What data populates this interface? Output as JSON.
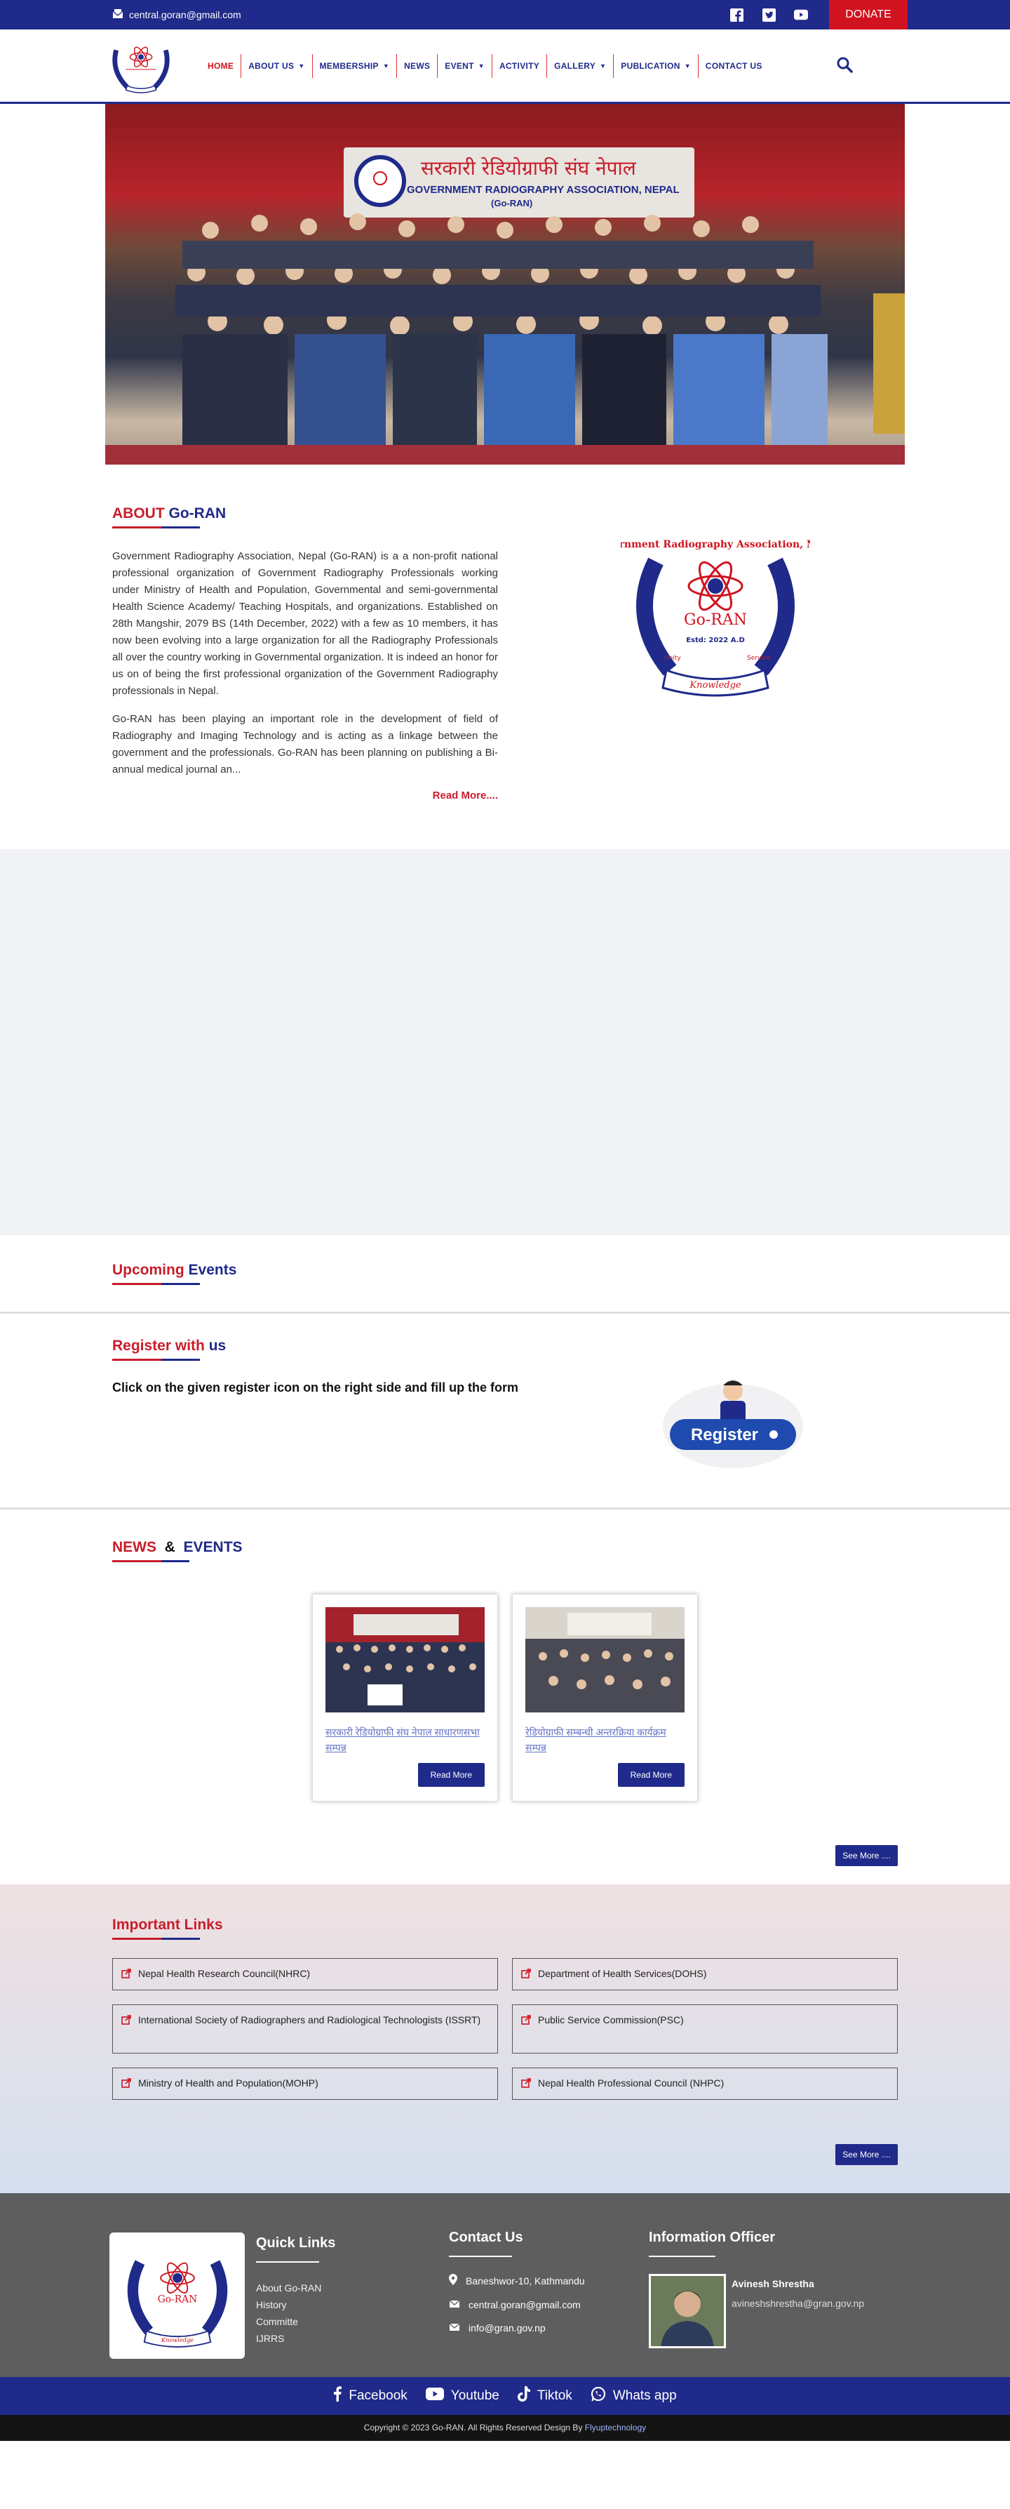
{
  "topbar": {
    "email": "central.goran@gmail.com",
    "donate": "DONATE",
    "social_icons": [
      "facebook-icon",
      "twitter-icon",
      "youtube-icon"
    ]
  },
  "nav": {
    "items": [
      {
        "label": "HOME",
        "dropdown": false
      },
      {
        "label": "ABOUT US",
        "dropdown": true
      },
      {
        "label": "MEMBERSHIP",
        "dropdown": true
      },
      {
        "label": "NEWS",
        "dropdown": false
      },
      {
        "label": "EVENT",
        "dropdown": true
      },
      {
        "label": "ACTIVITY",
        "dropdown": false
      },
      {
        "label": "GALLERY",
        "dropdown": true
      },
      {
        "label": "PUBLICATION",
        "dropdown": true
      },
      {
        "label": "CONTACT US",
        "dropdown": false
      }
    ]
  },
  "hero": {
    "banner_nepali": "सरकारी रेडियोग्राफी संघ नेपाल",
    "banner_english": "GOVERNMENT RADIOGRAPHY ASSOCIATION, NEPAL",
    "banner_abbr": "(Go-RAN)"
  },
  "about": {
    "title_a": "ABOUT",
    "title_b": "Go-RAN",
    "p1": "Government Radiography Association, Nepal (Go-RAN)  is a a non-profit national professional organization of Government Radiography Professionals working under Ministry of Health and Population, Governmental and semi-governmental Health Science Academy/ Teaching Hospitals, and  organizations. Established on 28th Mangshir, 2079 BS (14th December, 2022) with a few as 10 members, it has now been evolving into a large organization for all the Radiography Professionals all over the country working in Governmental organization. It is indeed an honor for us on of being the first professional organization of the Government Radiography professionals in Nepal.",
    "p2": "Go-RAN has been playing an important role in the development of field of Radiography and Imaging Technology and is acting as a linkage between the government and the professionals. Go-RAN has been planning on publishing a Bi-annual medical journal an...",
    "read_more": "Read More....",
    "logo_text": {
      "arc": "Government Radiography Association, Nepal",
      "name": "Go-RAN",
      "estd": "Estd: 2022 A.D",
      "ribbon": "Knowledge",
      "left": "Unity",
      "right": "Service"
    }
  },
  "upcoming": {
    "title_a": "Upcoming",
    "title_b": "Events"
  },
  "register": {
    "title_a": "Register with",
    "title_b": "us",
    "info": "Click on the given register icon on the right side and fill up the form",
    "button": "Register"
  },
  "news": {
    "title_a": "NEWS",
    "amp": "&",
    "title_b": "EVENTS",
    "cards": [
      {
        "caption": "सरकारी रेडियोग्राफी संघ नेपाल साधारणसभा सम्पन्न",
        "button": "Read More"
      },
      {
        "caption": "रेडियोग्राफी सम्बन्धी अन्तरक्रिया कार्यक्रम सम्पन्न",
        "button": "Read More"
      }
    ],
    "see_more": "See More ...."
  },
  "links": {
    "title": "Important Links",
    "items": [
      "Nepal Health Research Council(NHRC)",
      "Department of Health Services(DOHS)",
      "International Society of Radiographers and Radiological Technologists (ISSRT)",
      "Public Service Commission(PSC)",
      "Ministry of Health and Population(MOHP)",
      "Nepal Health Professional Council (NHPC)"
    ],
    "see_more": "See More ...."
  },
  "footer": {
    "quick_title": "Quick Links",
    "quick": [
      "About Go-RAN",
      "History",
      "Committe",
      "IJRRS"
    ],
    "contact_title": "Contact Us",
    "address": "Baneshwor-10, Kathmandu",
    "email": "central.goran@gmail.com",
    "email2": "info@gran.gov.np",
    "officer_title": "Information Officer",
    "officer_name": "Avinesh Shrestha",
    "officer_email": "avineshshrestha@gran.gov.np"
  },
  "social_bar": [
    "Facebook",
    "Youtube",
    "Tiktok",
    "Whats app"
  ],
  "copyright": {
    "text": "Copyright © 2023 Go-RAN. All Rights Reserved Design By",
    "designer": "Flyuptechnology"
  },
  "colors": {
    "primary": "#1f2a8a",
    "accent": "#d0131f"
  }
}
